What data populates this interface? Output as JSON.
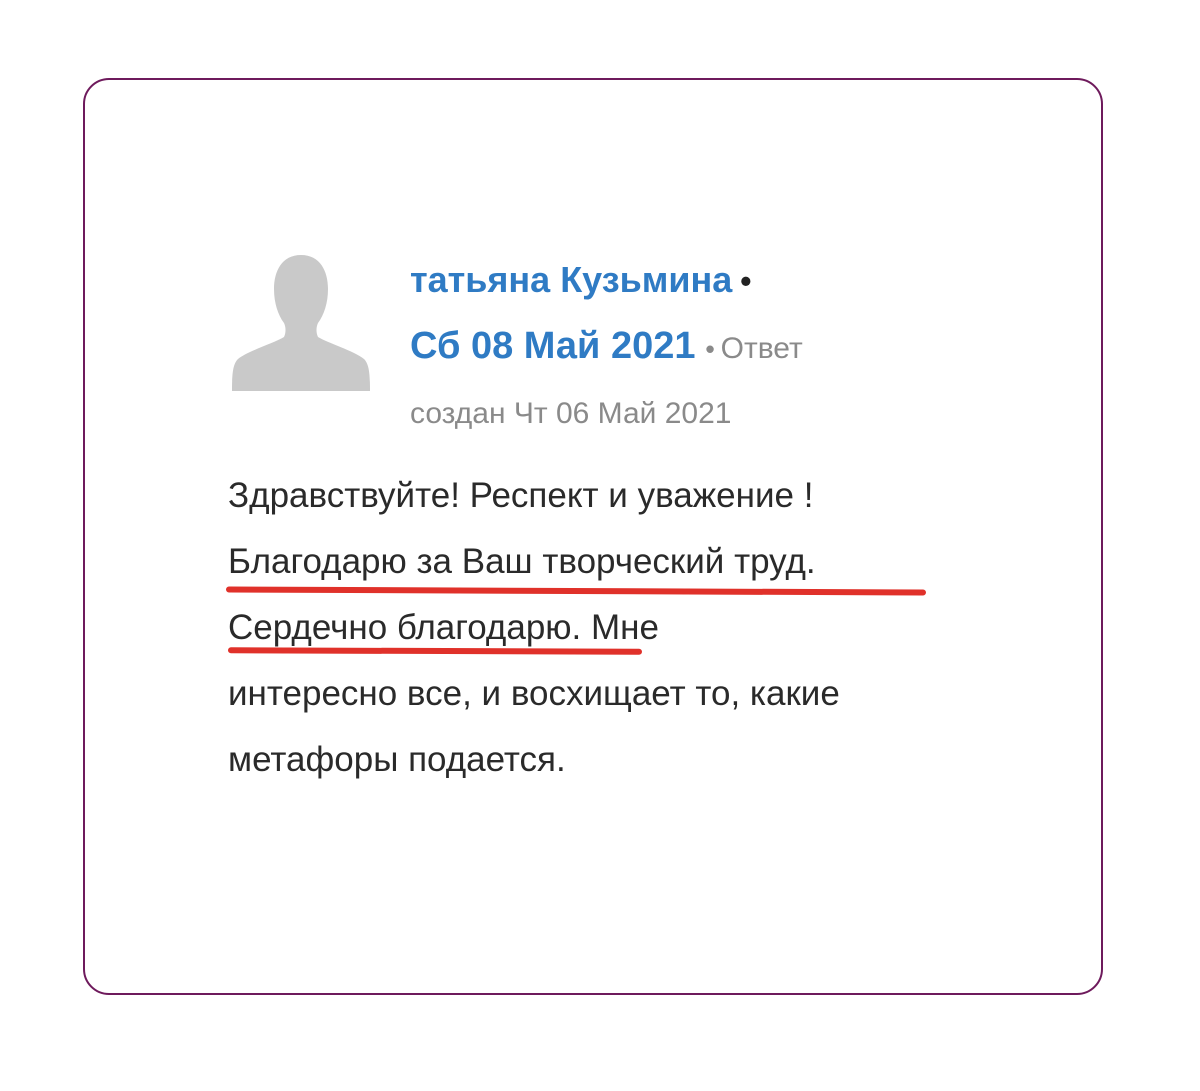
{
  "comment": {
    "author": "татьяна Кузьмина",
    "separator": "•",
    "date": "Сб 08 Май 2021",
    "date_separator": "•",
    "reply_label": "Ответ",
    "created": "создан Чт 06 Май 2021",
    "text_lines": [
      "Здравствуйте! Респект и уважение !",
      "Благодарю за Ваш творческий труд.",
      "Сердечно благодарю. Мне",
      "интересно все, и восхищает то, какие",
      "метафоры подается."
    ]
  },
  "icons": {
    "avatar": "user-silhouette-icon"
  },
  "colors": {
    "card_border": "#6e1a5c",
    "link_blue": "#2f7bc4",
    "meta_grey": "#8a8a8a",
    "body_text": "#2a2a2a",
    "highlight_red": "#e0312a"
  }
}
